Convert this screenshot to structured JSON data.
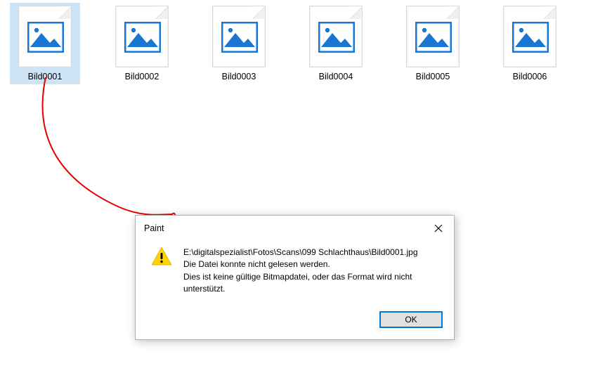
{
  "files": [
    {
      "label": "Bild0001",
      "selected": true
    },
    {
      "label": "Bild0002",
      "selected": false
    },
    {
      "label": "Bild0003",
      "selected": false
    },
    {
      "label": "Bild0004",
      "selected": false
    },
    {
      "label": "Bild0005",
      "selected": false
    },
    {
      "label": "Bild0006",
      "selected": false
    }
  ],
  "dialog": {
    "title": "Paint",
    "path": "E:\\digitalspezialist\\Fotos\\Scans\\099 Schlachthaus\\Bild0001.jpg",
    "line1": "Die Datei konnte nicht gelesen werden.",
    "line2": "Dies ist keine gültige Bitmapdatei, oder das Format wird nicht unterstützt.",
    "ok_label": "OK"
  },
  "colors": {
    "icon_blue": "#1976D2",
    "selection": "#cde4f7",
    "dialog_accent": "#0078d7",
    "annotation": "#e80000"
  }
}
